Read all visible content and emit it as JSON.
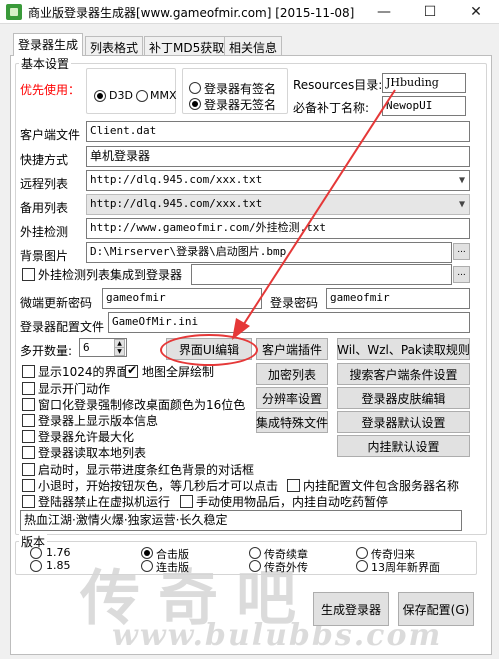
{
  "window": {
    "title": "商业版登录器生成器[www.gameofmir.com] [2015-11-08]",
    "minimize": "—",
    "maximize": "☐",
    "close": "✕"
  },
  "tabs": [
    "登录器生成",
    "列表格式",
    "补丁MD5获取",
    "相关信息"
  ],
  "basic": {
    "legend": "基本设置",
    "priority_label": "优先使用：",
    "d3d": "D3D",
    "mmx": "MMX",
    "sig_yes": "登录器有签名",
    "sig_no": "登录器无签名",
    "resources_label": "Resources目录:",
    "resources_value": "JHbuding",
    "patch_label": "必备补丁名称:",
    "patch_value": "NewopUI",
    "client_label": "客户端文件",
    "client_value": "Client.dat",
    "shortcut_label": "快捷方式",
    "shortcut_value": "单机登录器",
    "remote_label": "远程列表",
    "remote_value": "http://dlq.945.com/xxx.txt",
    "backup_label": "备用列表",
    "backup_value": "http://dlq.945.com/xxx.txt",
    "plugin_label": "外挂检测",
    "plugin_value": "http://www.gameofmir.com/外挂检测.txt",
    "bg_label": "背景图片",
    "bg_value": "D:\\Mirserver\\登录器\\启动图片.bmp",
    "dots": "...",
    "integrate_label": "外挂检测列表集成到登录器",
    "micro_pw_label": "微端更新密码",
    "micro_pw_value": "gameofmir",
    "login_pw_label": "登录密码",
    "login_pw_value": "gameofmir",
    "config_label": "登录器配置文件",
    "config_value": "GameOfMir.ini",
    "multi_label": "多开数量:",
    "multi_value": "6"
  },
  "checks": [
    {
      "label": "显示1024的界面",
      "on": false
    },
    {
      "label": "地图全屏绘制",
      "on": true
    },
    {
      "label": "显示开门动作",
      "on": false
    },
    {
      "label": "窗口化登录强制修改桌面颜色为16位色",
      "on": false
    },
    {
      "label": "登录器上显示版本信息",
      "on": false
    },
    {
      "label": "登录器允许最大化",
      "on": false
    },
    {
      "label": "登录器读取本地列表",
      "on": false
    },
    {
      "label": "启动时，显示带进度条红色背景的对话框",
      "on": false
    },
    {
      "label": "小退时，开始按钮灰色，等几秒后才可以点击",
      "on": false
    },
    {
      "label": "内挂配置文件包含服务器名称",
      "on": false
    },
    {
      "label": "登陆器禁止在虚拟机运行",
      "on": false
    },
    {
      "label": "手动使用物品后，内挂自动吃药暂停",
      "on": false
    }
  ],
  "buttons": {
    "ui_edit": "界面UI编辑",
    "client_plugin": "客户端插件",
    "read_rules": "Wil、Wzl、Pak读取规则",
    "encrypt_list": "加密列表",
    "search_conditions": "搜索客户端条件设置",
    "resolution": "分辨率设置",
    "skin_edit": "登录器皮肤编辑",
    "integrate_files": "集成特殊文件",
    "default_settings": "登录器默认设置",
    "plugin_defaults": "内挂默认设置",
    "generate": "生成登录器",
    "save_config": "保存配置(G)"
  },
  "slogan": "热血江湖·激情火爆·独家运营·长久稳定",
  "version": {
    "legend": "版本",
    "options": [
      {
        "label": "1.76",
        "on": false
      },
      {
        "label": "合击版",
        "on": true
      },
      {
        "label": "传奇续章",
        "on": false
      },
      {
        "label": "传奇归来",
        "on": false
      },
      {
        "label": "1.85",
        "on": false
      },
      {
        "label": "连击版",
        "on": false
      },
      {
        "label": "传奇外传",
        "on": false
      },
      {
        "label": "13周年新界面",
        "on": false
      }
    ]
  },
  "watermark": {
    "text": "传奇吧",
    "url": "www.bulubbs.com"
  },
  "colors": {
    "highlight": "#e53838",
    "accent_red": "#ff0000"
  }
}
